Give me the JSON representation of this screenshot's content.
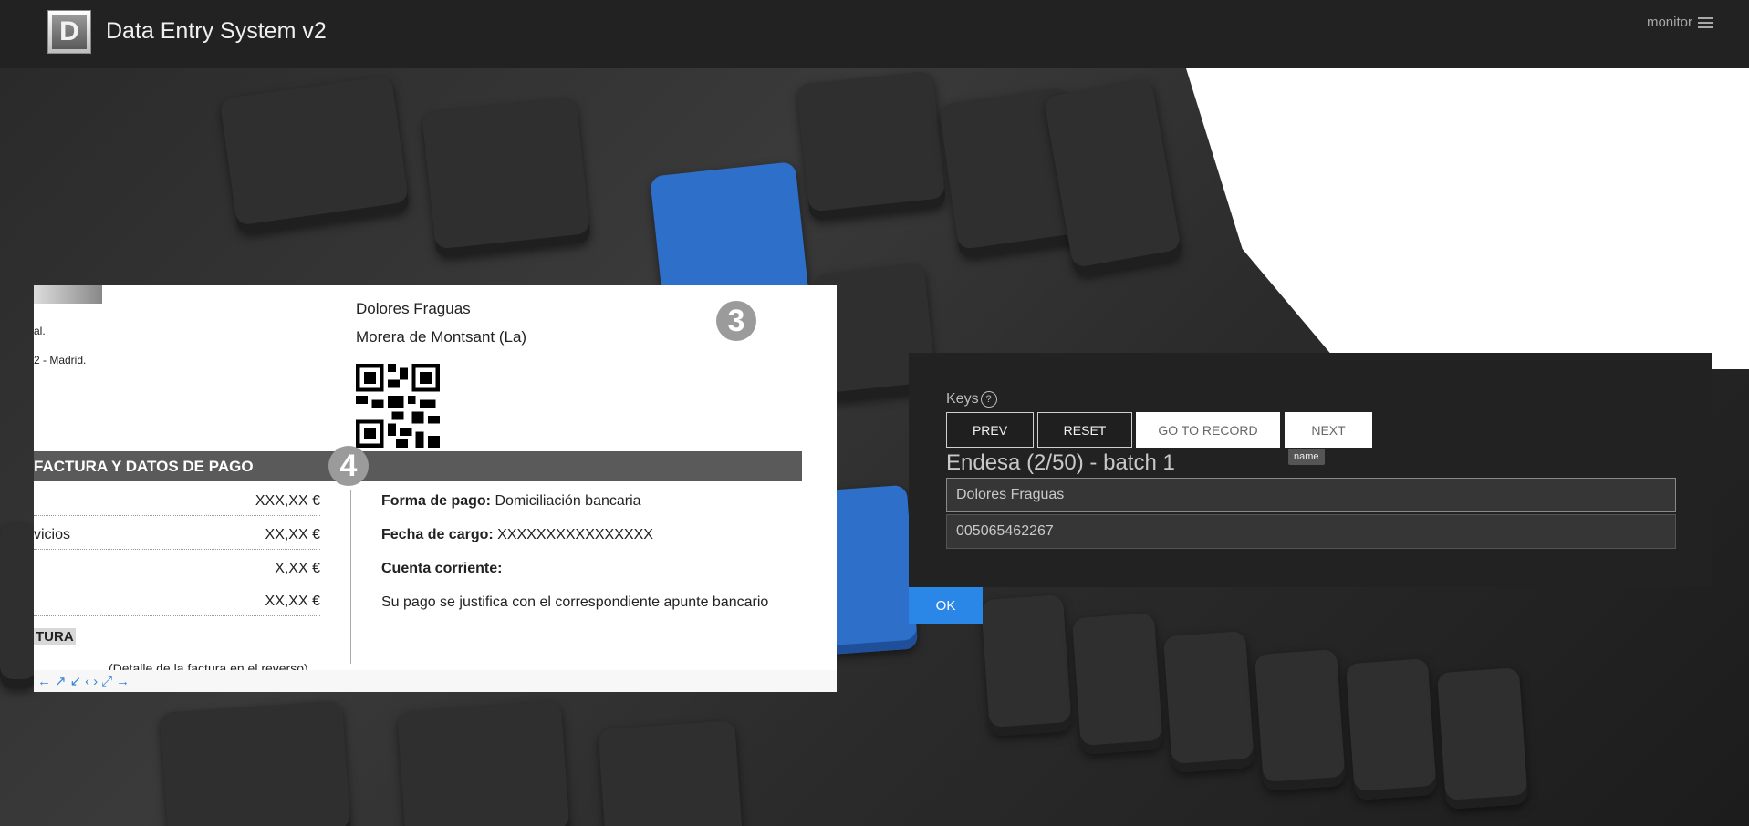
{
  "header": {
    "logo_letter": "D",
    "title": "Data Entry System v2",
    "user": "monitor"
  },
  "document": {
    "marker_top": "3",
    "marker_section": "4",
    "customer_name": "Dolores Fraguas",
    "customer_city": "Morera de Montsant (La)",
    "address_line1": "al.",
    "address_line2": "2 - Madrid.",
    "section_title": "FACTURA Y DATOS DE PAGO",
    "amount_rows": [
      {
        "label": "",
        "value": "XXX,XX €"
      },
      {
        "label": "vicios",
        "value": "XX,XX €"
      },
      {
        "label": "",
        "value": "X,XX €"
      },
      {
        "label": "",
        "value": "XX,XX €"
      }
    ],
    "total_label": "TURA",
    "detail_note": "(Detalle de la factura en el reverso)",
    "payment_method_label": "Forma de pago:",
    "payment_method_value": "Domiciliación bancaria",
    "charge_date_label": "Fecha de cargo:",
    "charge_date_value": "XXXXXXXXXXXXXXXX",
    "account_label": "Cuenta corriente:",
    "payment_note": "Su pago se justifica con el correspondiente apunte bancario"
  },
  "viewer_tools": [
    "←",
    "↗",
    "↙",
    "‹",
    "›",
    "⤢",
    "→"
  ],
  "panel": {
    "keys_label": "Keys",
    "help_glyph": "?",
    "buttons": {
      "prev": "PREV",
      "reset": "RESET",
      "go_to_record": "GO TO RECORD",
      "next": "NEXT"
    },
    "tooltip": "name",
    "record_title": "Endesa (2/50) - batch 1",
    "fields": {
      "name_value": "Dolores Fraguas",
      "id_value": "005065462267"
    },
    "ok_label": "OK"
  },
  "colors": {
    "header_bg": "#222222",
    "panel_bg": "#222222",
    "accent_blue": "#2a87e8",
    "section_bar": "#5a5a5a"
  }
}
